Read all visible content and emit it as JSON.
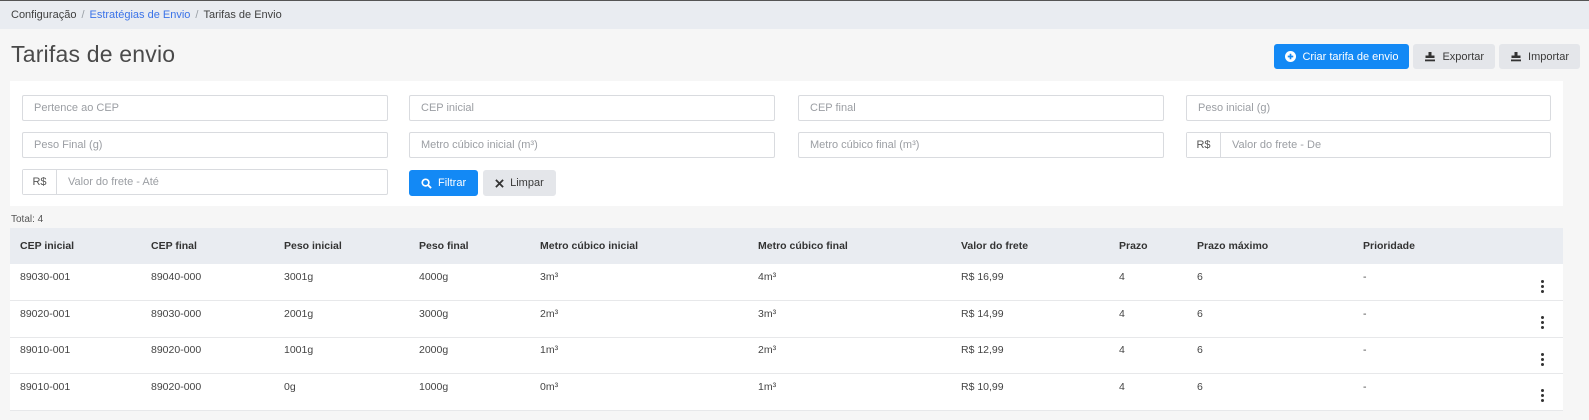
{
  "breadcrumb": {
    "items": [
      {
        "label": "Configuração",
        "link": false
      },
      {
        "label": "Estratégias de Envio",
        "link": true
      },
      {
        "label": "Tarifas de Envio",
        "link": false
      }
    ],
    "separator": "/"
  },
  "page": {
    "title": "Tarifas de envio"
  },
  "actions": {
    "create_label": "Criar tarifa de envio",
    "export_label": "Exportar",
    "import_label": "Importar"
  },
  "filters": {
    "cep_belongs": {
      "placeholder": "Pertence ao CEP",
      "value": ""
    },
    "cep_start": {
      "placeholder": "CEP inicial",
      "value": ""
    },
    "cep_end": {
      "placeholder": "CEP final",
      "value": ""
    },
    "weight_start": {
      "placeholder": "Peso inicial (g)",
      "value": ""
    },
    "weight_end": {
      "placeholder": "Peso Final (g)",
      "value": ""
    },
    "cubic_start": {
      "placeholder": "Metro cúbico inicial (m³)",
      "value": ""
    },
    "cubic_end": {
      "placeholder": "Metro cúbico final (m³)",
      "value": ""
    },
    "price_from": {
      "prefix": "R$",
      "placeholder": "Valor do frete - De",
      "value": ""
    },
    "price_to": {
      "prefix": "R$",
      "placeholder": "Valor do frete - Até",
      "value": ""
    },
    "filter_label": "Filtrar",
    "clear_label": "Limpar"
  },
  "table": {
    "total_label": "Total: 4",
    "headers": [
      "CEP inicial",
      "CEP final",
      "Peso inicial",
      "Peso final",
      "Metro cúbico inicial",
      "Metro cúbico final",
      "Valor do frete",
      "Prazo",
      "Prazo máximo",
      "Prioridade"
    ],
    "rows": [
      [
        "89030-001",
        "89040-000",
        "3001g",
        "4000g",
        "3m³",
        "4m³",
        "R$ 16,99",
        "4",
        "6",
        "-"
      ],
      [
        "89020-001",
        "89030-000",
        "2001g",
        "3000g",
        "2m³",
        "3m³",
        "R$ 14,99",
        "4",
        "6",
        "-"
      ],
      [
        "89010-001",
        "89020-000",
        "1001g",
        "2000g",
        "1m³",
        "2m³",
        "R$ 12,99",
        "4",
        "6",
        "-"
      ],
      [
        "89010-001",
        "89020-000",
        "0g",
        "1000g",
        "0m³",
        "1m³",
        "R$ 10,99",
        "4",
        "6",
        "-"
      ]
    ]
  },
  "colors": {
    "accent": "#1389f5",
    "link": "#3b73e8",
    "header_bg": "#e9ecf1"
  },
  "icons": {
    "create": "plus-circle-icon",
    "export": "stamp-icon",
    "import": "stamp-icon",
    "filter": "search-icon",
    "clear": "close-icon",
    "row_menu": "kebab-menu-icon"
  }
}
